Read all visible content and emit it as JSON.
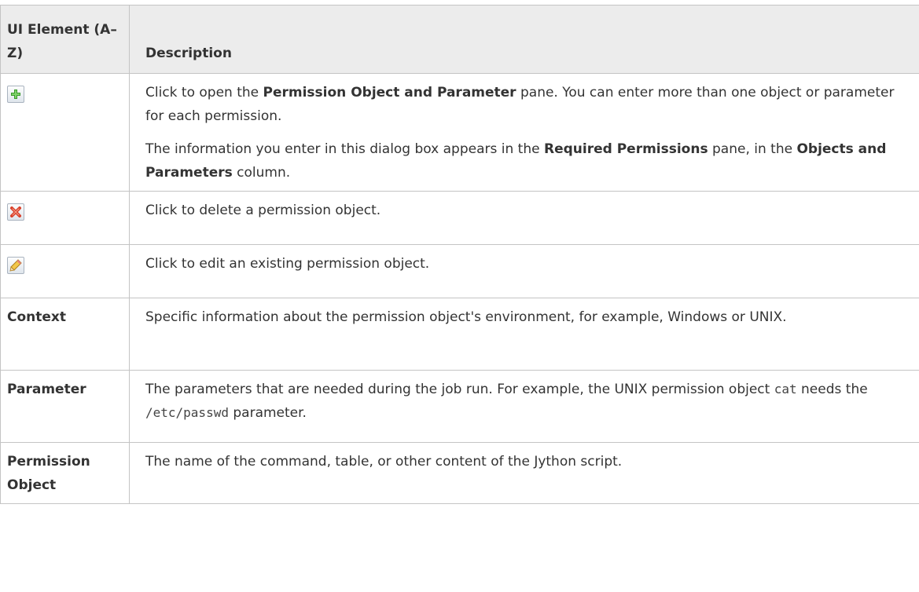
{
  "header": {
    "col1": "UI Element (A–Z)",
    "col2": "Description"
  },
  "rows": [
    {
      "icon": "add-icon",
      "desc": [
        [
          "Click to open the ",
          "Permission Object and Parameter",
          " pane. You can enter more than one object or parameter for each permission."
        ],
        [
          "The information you enter in this dialog box appears in the ",
          "Required Permissions",
          " pane, in the ",
          "Objects and Parameters",
          " column."
        ]
      ]
    },
    {
      "icon": "delete-icon",
      "desc": "Click to delete a permission object."
    },
    {
      "icon": "edit-icon",
      "desc": "Click to edit an existing permission object."
    },
    {
      "name": "Context",
      "desc": "Specific information about the permission object's environment, for example, Windows or UNIX."
    },
    {
      "name": "Parameter",
      "desc": [
        "The parameters that are needed during the job run. For example, the UNIX permission object ",
        "cat",
        " needs the ",
        "/etc/passwd",
        " parameter."
      ]
    },
    {
      "name": "Permission Object",
      "desc": "The name of the command, table, or other content of the Jython script."
    }
  ],
  "colors": {
    "header_bg": "#ececec",
    "border": "#c4c4c4",
    "text": "#333333",
    "add_green": "#3a9a2a",
    "delete_red": "#d9412b",
    "edit_pencil": "#e0a83a"
  }
}
